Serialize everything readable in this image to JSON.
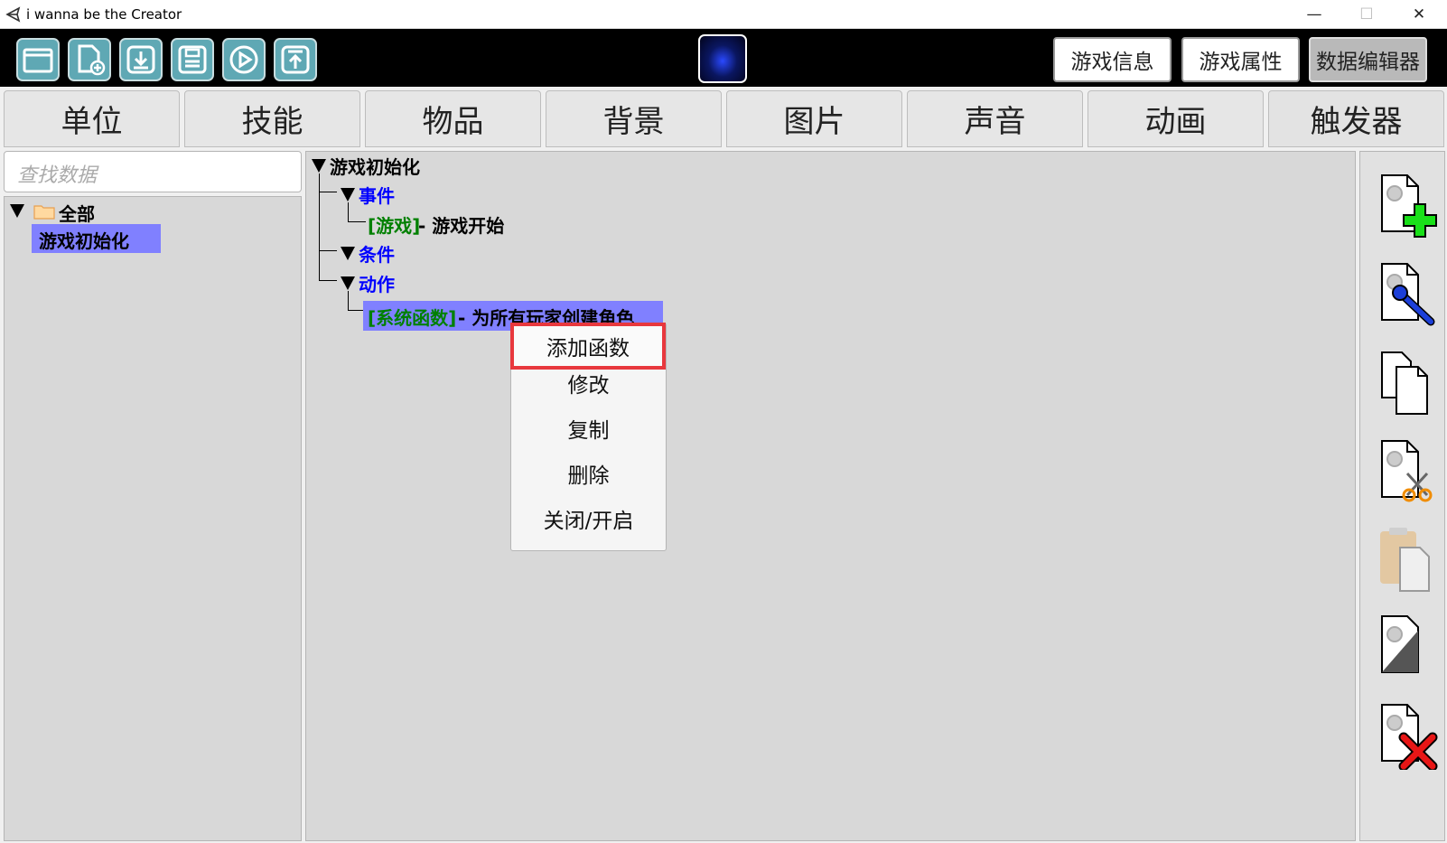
{
  "window": {
    "title": "i wanna be the Creator",
    "minimize_glyph": "—",
    "maximize_glyph": "☐",
    "close_glyph": "✕"
  },
  "toolbar": {
    "icons": [
      "folder-icon",
      "new-file-icon",
      "download-icon",
      "save-icon",
      "play-icon",
      "upload-icon"
    ],
    "top_tabs": [
      {
        "label": "游戏信息",
        "active": false
      },
      {
        "label": "游戏属性",
        "active": false
      },
      {
        "label": "数据编辑器",
        "active": true
      }
    ]
  },
  "categories": [
    "单位",
    "技能",
    "物品",
    "背景",
    "图片",
    "声音",
    "动画",
    "触发器"
  ],
  "active_category": "触发器",
  "left": {
    "search_placeholder": "查找数据",
    "root_label": "全部",
    "items": [
      "游戏初始化"
    ]
  },
  "tree": {
    "root": "游戏初始化",
    "events_label": "事件",
    "event_tag": "[游戏]",
    "event_text": " - 游戏开始",
    "conditions_label": "条件",
    "actions_label": "动作",
    "action_tag": "[系统函数]",
    "action_text": " - 为所有玩家创建角色"
  },
  "context_menu": {
    "items": [
      "添加函数",
      "修改",
      "复制",
      "删除",
      "关闭/开启"
    ]
  },
  "sidebar": {
    "icons": [
      "add-trigger-icon",
      "edit-trigger-icon",
      "copy-trigger-icon",
      "cut-trigger-icon",
      "paste-trigger-icon",
      "toggle-trigger-icon",
      "delete-trigger-icon"
    ]
  },
  "colors": {
    "selection": "#8080ff",
    "highlight_outline": "#e8383d",
    "toolbar_button": "#5fa8b4"
  }
}
